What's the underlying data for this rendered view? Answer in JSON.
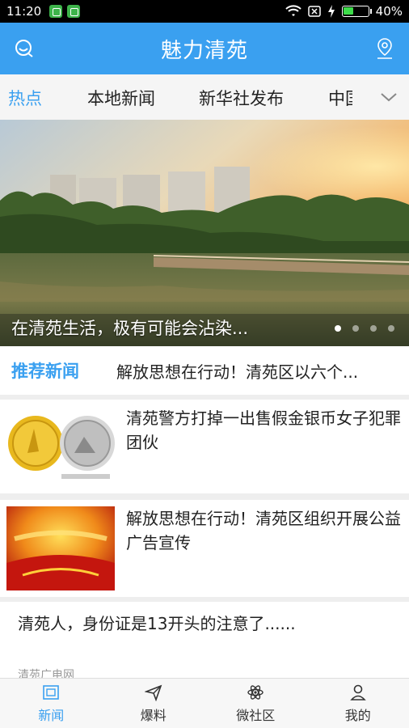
{
  "status_bar": {
    "time": "11:20",
    "battery": "40%"
  },
  "header": {
    "title": "魅力清苑",
    "left_icon": "search-chat-icon",
    "right_icon": "location-pin-icon"
  },
  "tabs": [
    {
      "label": "热点",
      "active": true
    },
    {
      "label": "本地新闻"
    },
    {
      "label": "新华社发布"
    },
    {
      "label": "中国"
    }
  ],
  "banner": {
    "caption": "在清苑生活，极有可能会沾染...",
    "slides": 4,
    "active_slide": 1
  },
  "recommend": {
    "tag": "推荐新闻",
    "headline": "解放思想在行动！清苑区以六个..."
  },
  "news": [
    {
      "title": "清苑警方打掉一出售假金银币女子犯罪团伙"
    },
    {
      "title": "解放思想在行动！清苑区组织开展公益广告宣传"
    },
    {
      "title": "清苑人，身份证是13开头的注意了......",
      "source": "清苑广电网"
    }
  ],
  "bottom_nav": [
    {
      "label": "新闻",
      "icon": "news-icon",
      "active": true
    },
    {
      "label": "爆料",
      "icon": "send-icon"
    },
    {
      "label": "微社区",
      "icon": "atom-icon"
    },
    {
      "label": "我的",
      "icon": "user-icon"
    }
  ],
  "colors": {
    "accent": "#3aa0f0"
  }
}
